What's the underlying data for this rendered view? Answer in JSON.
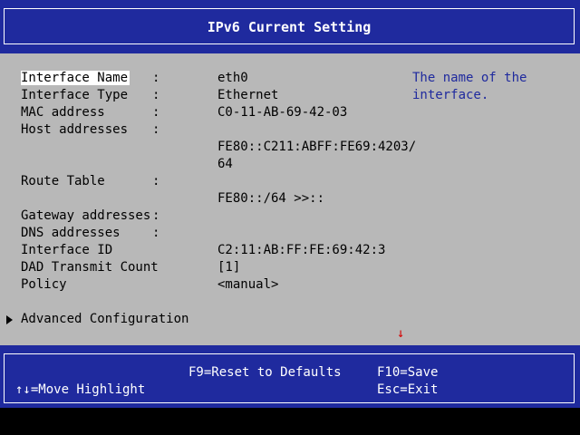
{
  "header": {
    "title": "IPv6 Current Setting"
  },
  "fields": [
    {
      "label": "Interface Name",
      "colon": ":",
      "value": "eth0"
    },
    {
      "label": "Interface Type",
      "colon": ":",
      "value": "Ethernet"
    },
    {
      "label": "MAC address",
      "colon": ":",
      "value": "C0-11-AB-69-42-03"
    },
    {
      "label": "Host addresses",
      "colon": ":",
      "value": ""
    },
    {
      "label": "",
      "colon": "",
      "value": "FE80::C211:ABFF:FE69:4203/"
    },
    {
      "label": "",
      "colon": "",
      "value": "64"
    },
    {
      "label": "Route Table",
      "colon": ":",
      "value": ""
    },
    {
      "label": "",
      "colon": "",
      "value": "FE80::/64 >>::"
    },
    {
      "label": "Gateway addresses",
      "colon": ":",
      "value": ""
    },
    {
      "label": "DNS addresses",
      "colon": ":",
      "value": ""
    },
    {
      "label": "Interface ID",
      "colon": "",
      "value": "C2:11:AB:FF:FE:69:42:3"
    },
    {
      "label": "DAD Transmit Count",
      "colon": "",
      "value": "[1]"
    },
    {
      "label": "Policy",
      "colon": "",
      "value": "<manual>"
    }
  ],
  "help_text": "The name of the interface.",
  "advanced": {
    "label": "Advanced Configuration"
  },
  "scroll_indicator": "↓",
  "footer": {
    "reset": "F9=Reset to Defaults",
    "save": "F10=Save",
    "move": "↑↓=Move Highlight",
    "exit": "Esc=Exit"
  },
  "colors": {
    "bar_blue": "#1f2a9e",
    "panel_gray": "#b8b8b8",
    "help_blue": "#1f2a9e",
    "arrow_red": "#d60000"
  }
}
